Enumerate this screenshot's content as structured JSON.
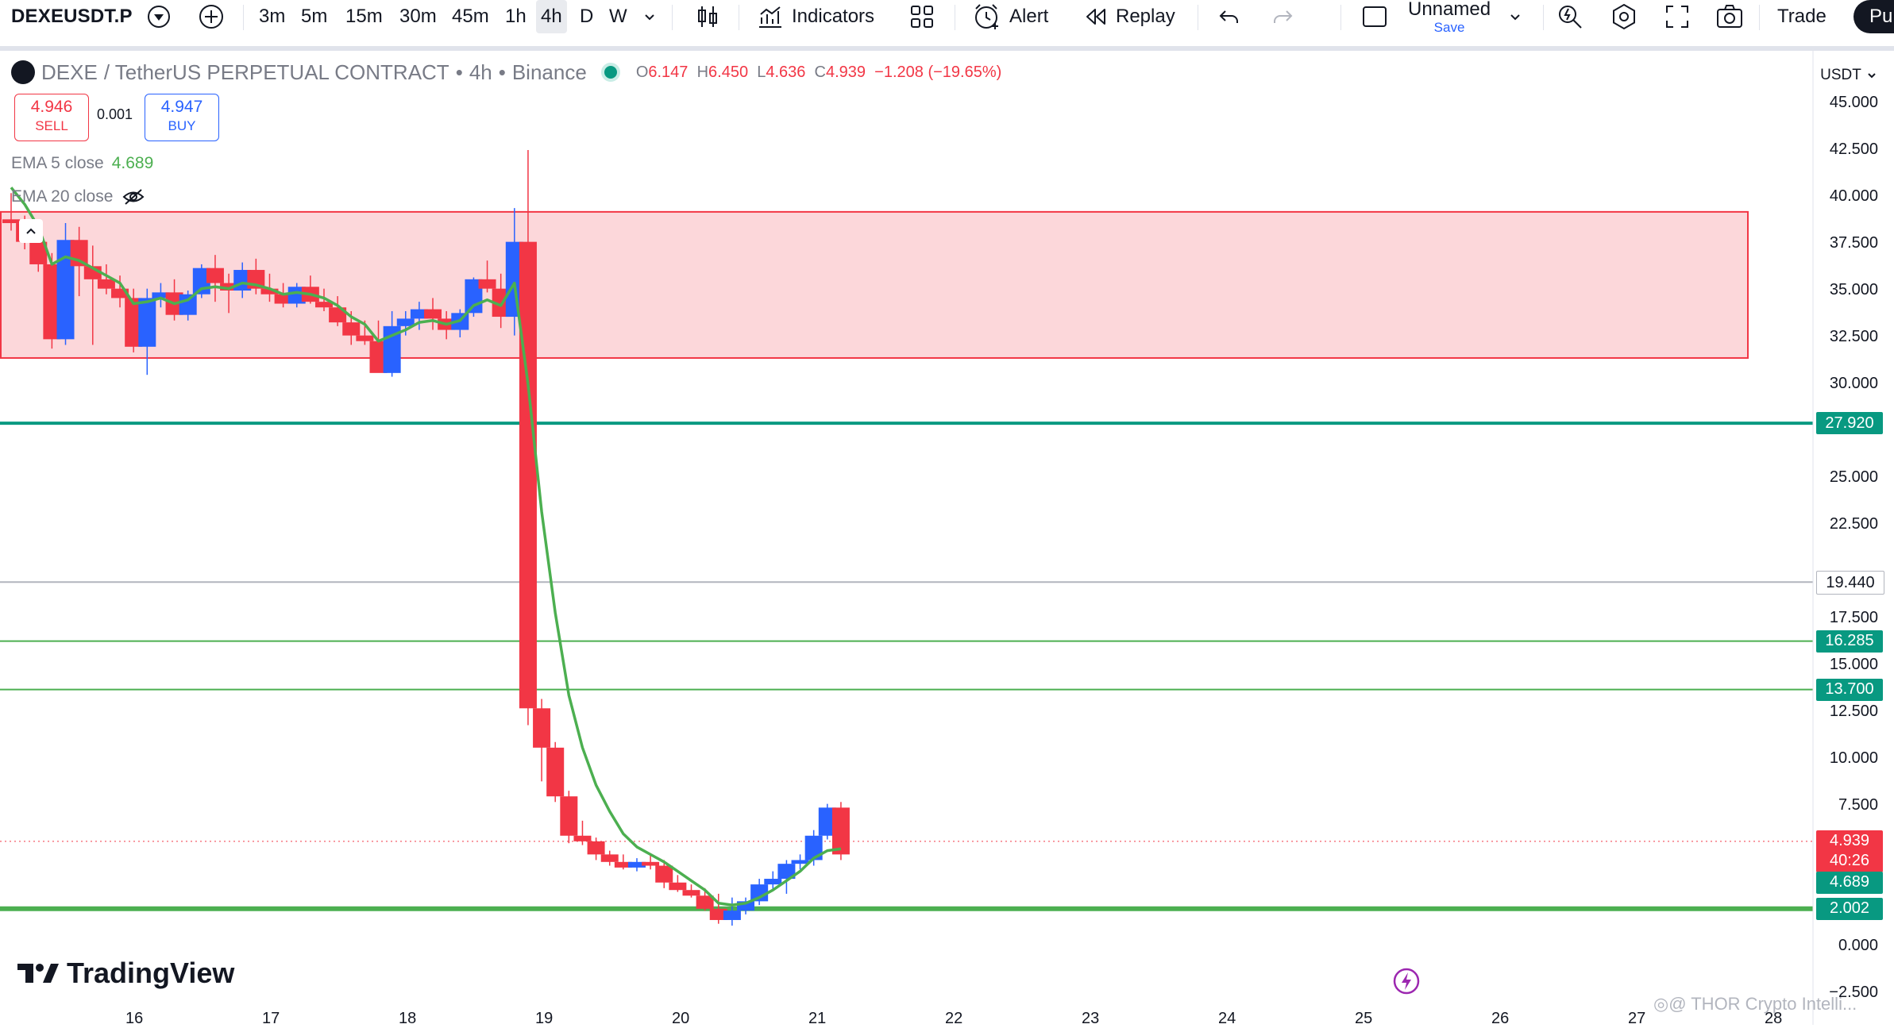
{
  "toolbar": {
    "symbol": "DEXEUSDT.P",
    "intervals": [
      "3m",
      "5m",
      "15m",
      "30m",
      "45m",
      "1h",
      "4h",
      "D",
      "W"
    ],
    "active_interval": "4h",
    "indicators_label": "Indicators",
    "alert_label": "Alert",
    "replay_label": "Replay",
    "layout_name": "Unnamed",
    "layout_save": "Save",
    "trade_label": "Trade",
    "publish_label": "Pu"
  },
  "legend": {
    "base": "DEXE",
    "pair_desc": "/ TetherUS PERPETUAL CONTRACT",
    "interval": "4h",
    "exchange": "Binance",
    "o_key": "O",
    "o": "6.147",
    "h_key": "H",
    "h": "6.450",
    "l_key": "L",
    "l": "4.636",
    "c_key": "C",
    "c": "4.939",
    "change": "−1.208 (−19.65%)"
  },
  "trade": {
    "sell_price": "4.946",
    "sell_label": "SELL",
    "spread": "0.001",
    "buy_price": "4.947",
    "buy_label": "BUY"
  },
  "indicators": {
    "ema5_label": "EMA 5 close",
    "ema5_value": "4.689",
    "ema20_label": "EMA 20 close"
  },
  "price_scale": {
    "currency": "USDT",
    "ticks": [
      "45.000",
      "42.500",
      "40.000",
      "37.500",
      "35.000",
      "32.500",
      "30.000",
      "25.000",
      "22.500",
      "17.500",
      "15.000",
      "12.500",
      "10.000",
      "7.500",
      "0.000",
      "−2.500"
    ],
    "tick_values": [
      45,
      42.5,
      40,
      37.5,
      35,
      32.5,
      30,
      25,
      22.5,
      17.5,
      15,
      12.5,
      10,
      7.5,
      0,
      -2.5
    ],
    "tags": [
      {
        "text": "27.920",
        "value": 27.92,
        "color": "#089981"
      },
      {
        "text": "19.440",
        "value": 19.44,
        "color": "#ffffff"
      },
      {
        "text": "16.285",
        "value": 16.285,
        "color": "#089981"
      },
      {
        "text": "13.700",
        "value": 13.7,
        "color": "#089981"
      },
      {
        "text": "4.939",
        "value": 5.6,
        "color": "#f23645"
      },
      {
        "text": "40:26",
        "value": 4.55,
        "color": "#f23645"
      },
      {
        "text": "4.689",
        "value": 3.4,
        "color": "#089981"
      },
      {
        "text": "2.002",
        "value": 2.002,
        "color": "#089981"
      }
    ]
  },
  "time_axis": [
    "16",
    "17",
    "18",
    "19",
    "20",
    "21",
    "22",
    "23",
    "24",
    "25",
    "26",
    "27",
    "28"
  ],
  "chart_data": {
    "type": "candlestick",
    "zone": {
      "top": 39.2,
      "bottom": 31.4,
      "color": "#f23645"
    },
    "hlines": [
      {
        "value": 27.92,
        "color": "#089981"
      },
      {
        "value": 19.44,
        "color": "#b2b5be"
      },
      {
        "value": 16.285,
        "color": "#4caf50"
      },
      {
        "value": 13.7,
        "color": "#4caf50"
      },
      {
        "value": 2.002,
        "color": "#4caf50"
      }
    ],
    "candles": [
      [
        38.8,
        40.2,
        38.2,
        38.6
      ],
      [
        38.6,
        39.0,
        37.2,
        37.6
      ],
      [
        37.6,
        38.4,
        36.0,
        36.4
      ],
      [
        36.4,
        37.0,
        31.9,
        32.4
      ],
      [
        32.4,
        38.6,
        32.1,
        37.7
      ],
      [
        37.7,
        38.4,
        34.7,
        36.3
      ],
      [
        36.3,
        37.4,
        32.1,
        35.6
      ],
      [
        35.6,
        36.4,
        34.8,
        35.1
      ],
      [
        35.1,
        35.8,
        34.1,
        34.6
      ],
      [
        34.6,
        35.1,
        31.7,
        32.0
      ],
      [
        32.0,
        35.1,
        30.5,
        34.6
      ],
      [
        34.6,
        35.4,
        34.1,
        34.9
      ],
      [
        34.9,
        35.6,
        33.4,
        33.7
      ],
      [
        33.7,
        35.0,
        33.4,
        34.8
      ],
      [
        34.8,
        36.4,
        34.6,
        36.2
      ],
      [
        36.2,
        36.9,
        34.4,
        35.4
      ],
      [
        35.4,
        35.9,
        33.8,
        35.0
      ],
      [
        35.0,
        36.5,
        34.6,
        36.1
      ],
      [
        36.1,
        36.7,
        34.8,
        35.1
      ],
      [
        35.1,
        35.9,
        34.4,
        34.8
      ],
      [
        34.8,
        35.4,
        34.1,
        34.3
      ],
      [
        34.3,
        35.4,
        34.1,
        35.2
      ],
      [
        35.2,
        35.8,
        34.3,
        34.4
      ],
      [
        34.4,
        35.1,
        33.9,
        34.1
      ],
      [
        34.1,
        34.7,
        33.1,
        33.3
      ],
      [
        33.3,
        33.9,
        32.1,
        32.6
      ],
      [
        32.6,
        33.4,
        32.1,
        32.3
      ],
      [
        32.3,
        33.4,
        30.9,
        30.6
      ],
      [
        30.6,
        33.9,
        30.4,
        33.1
      ],
      [
        33.1,
        33.9,
        32.6,
        33.5
      ],
      [
        33.5,
        34.4,
        32.9,
        34.0
      ],
      [
        34.0,
        34.6,
        32.9,
        33.5
      ],
      [
        33.5,
        33.9,
        32.4,
        32.9
      ],
      [
        32.9,
        34.0,
        32.5,
        33.8
      ],
      [
        33.8,
        35.7,
        33.6,
        35.6
      ],
      [
        35.6,
        36.6,
        34.9,
        35.1
      ],
      [
        35.1,
        35.9,
        33.0,
        33.6
      ],
      [
        33.6,
        39.4,
        32.6,
        37.6
      ],
      [
        37.6,
        42.5,
        11.8,
        12.7
      ],
      [
        12.7,
        13.2,
        8.8,
        10.6
      ],
      [
        10.6,
        10.9,
        7.7,
        8.0
      ],
      [
        8.0,
        8.3,
        5.5,
        5.9
      ],
      [
        5.9,
        6.7,
        5.4,
        5.6
      ],
      [
        5.6,
        5.8,
        4.6,
        4.9
      ],
      [
        4.9,
        5.1,
        4.3,
        4.5
      ],
      [
        4.5,
        4.9,
        4.1,
        4.2
      ],
      [
        4.2,
        4.7,
        4.0,
        4.5
      ],
      [
        4.5,
        4.9,
        4.1,
        4.3
      ],
      [
        4.3,
        4.6,
        3.1,
        3.4
      ],
      [
        3.4,
        3.8,
        2.9,
        3.0
      ],
      [
        3.0,
        3.3,
        2.6,
        2.7
      ],
      [
        2.7,
        3.1,
        1.9,
        2.0
      ],
      [
        2.0,
        2.8,
        1.2,
        1.4
      ],
      [
        1.4,
        2.6,
        1.1,
        1.9
      ],
      [
        1.9,
        2.6,
        1.7,
        2.4
      ],
      [
        2.4,
        3.6,
        2.2,
        3.3
      ],
      [
        3.3,
        4.0,
        3.0,
        3.6
      ],
      [
        3.6,
        4.6,
        2.8,
        4.4
      ],
      [
        4.4,
        4.9,
        4.1,
        4.6
      ],
      [
        4.6,
        6.2,
        4.3,
        5.9
      ],
      [
        5.9,
        7.6,
        5.7,
        7.4
      ],
      [
        7.4,
        7.7,
        4.6,
        4.9
      ]
    ],
    "ema5": [
      40.5,
      39.6,
      38.4,
      36.4,
      36.8,
      36.6,
      36.2,
      35.8,
      35.4,
      34.3,
      34.4,
      34.6,
      34.3,
      34.5,
      35.1,
      35.2,
      35.1,
      35.4,
      35.3,
      35.1,
      34.8,
      34.9,
      34.8,
      34.6,
      34.2,
      33.6,
      33.2,
      32.3,
      32.6,
      32.9,
      33.3,
      33.4,
      33.2,
      33.4,
      34.2,
      34.5,
      34.2,
      35.4,
      30.0,
      23.2,
      17.8,
      13.4,
      10.6,
      8.6,
      7.2,
      6.0,
      5.3,
      4.9,
      4.5,
      4.0,
      3.5,
      3.0,
      2.3,
      2.2,
      2.3,
      2.6,
      3.0,
      3.5,
      4.0,
      4.7,
      5.1,
      5.2
    ]
  }
}
